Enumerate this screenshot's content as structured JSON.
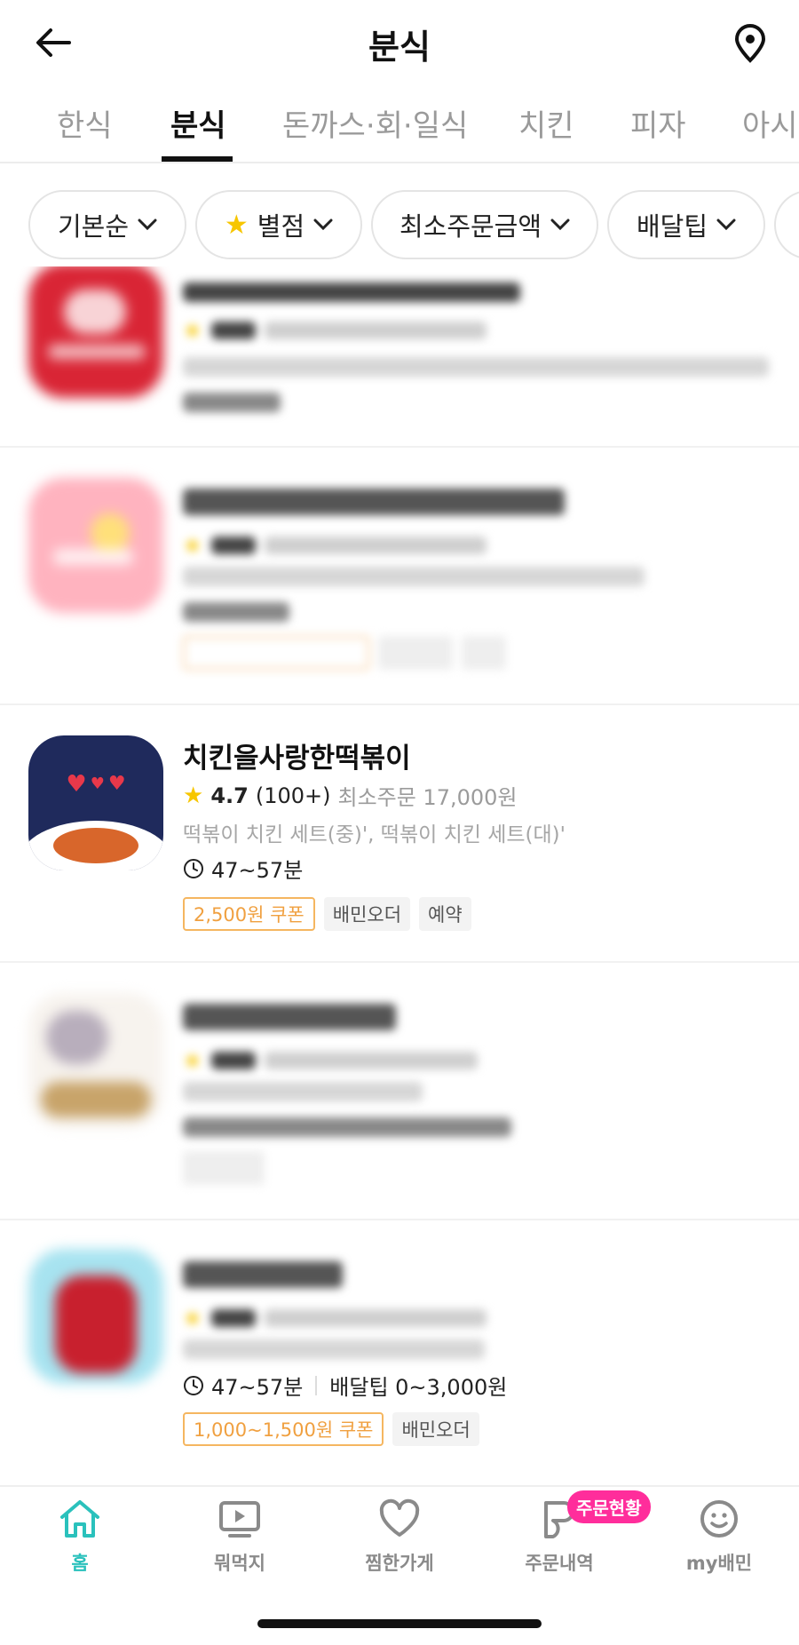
{
  "header": {
    "title": "분식"
  },
  "tabs": [
    {
      "label": "한식",
      "active": false
    },
    {
      "label": "분식",
      "active": true
    },
    {
      "label": "돈까스·회·일식",
      "active": false
    },
    {
      "label": "치킨",
      "active": false
    },
    {
      "label": "피자",
      "active": false
    },
    {
      "label": "아시",
      "active": false
    }
  ],
  "filters": [
    {
      "label": "기본순"
    },
    {
      "label": "별점"
    },
    {
      "label": "최소주문금액"
    },
    {
      "label": "배달팁"
    }
  ],
  "stores": [
    {
      "name": "",
      "blurred": true,
      "rating": "",
      "count": "",
      "min_order": "",
      "menu": "",
      "time": ""
    },
    {
      "name": "",
      "blurred": true,
      "rating": "",
      "count": "",
      "min_order": "",
      "menu": "",
      "time": ""
    },
    {
      "name": "치킨을사랑한떡볶이",
      "blurred": false,
      "rating": "4.7",
      "count": "(100+)",
      "min_order": "최소주문 17,000원",
      "menu": "떡볶이 치킨 세트(중)', 떡볶이 치킨 세트(대)'",
      "time": "47~57분",
      "badges": [
        "2,500원 쿠폰",
        "배민오더",
        "예약"
      ]
    },
    {
      "name": "",
      "blurred": true
    },
    {
      "name": "",
      "blurred": true,
      "time": "47~57분",
      "delivery_tip": "배달팁 0~3,000원",
      "badges": [
        "1,000~1,500원 쿠폰",
        "배민오더"
      ]
    }
  ],
  "bottom_nav": [
    {
      "label": "홈",
      "icon": "home-icon",
      "active": true
    },
    {
      "label": "뭐먹지",
      "icon": "play-icon",
      "active": false
    },
    {
      "label": "찜한가게",
      "icon": "heart-icon",
      "active": false
    },
    {
      "label": "주문내역",
      "icon": "receipt-icon",
      "active": false,
      "badge": "주문현황"
    },
    {
      "label": "my배민",
      "icon": "smile-icon",
      "active": false
    }
  ],
  "colors": {
    "accent": "#2ac1bc",
    "coupon": "#f0a040",
    "star": "#f7c600",
    "badge_pink": "#ff2d9b"
  }
}
